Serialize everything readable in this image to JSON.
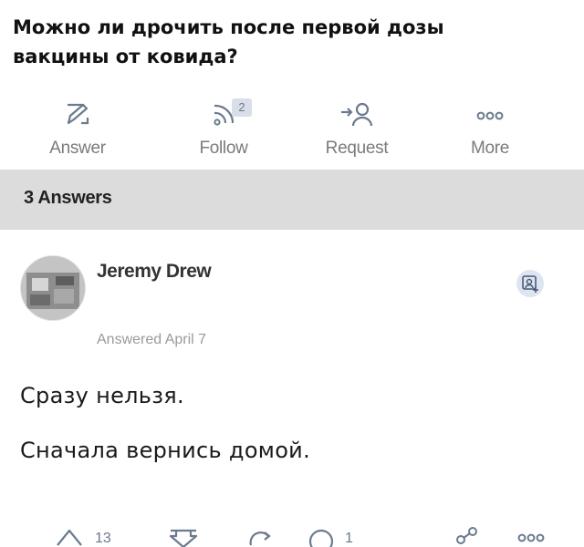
{
  "question": {
    "title": "Можно ли дрочить после первой дозы вакцины от ковида?"
  },
  "actions": [
    {
      "label": "Answer",
      "icon": "pencil-icon"
    },
    {
      "label": "Follow",
      "icon": "rss-icon",
      "count": "2"
    },
    {
      "label": "Request",
      "icon": "request-user-icon"
    },
    {
      "label": "More",
      "icon": "more-dots-icon"
    }
  ],
  "answers_header": {
    "label": "3 Answers"
  },
  "answer": {
    "author": "Jeremy Drew",
    "meta": "Answered April 7",
    "paragraphs": [
      "Сразу нельзя.",
      "Сначала вернись домой."
    ]
  },
  "footer": {
    "upvotes": "13",
    "comments": "1"
  },
  "colors": {
    "icon_blue": "#6b7a8e",
    "label_gray": "#7b7b7b",
    "answers_bar_bg": "#dcdcdc"
  }
}
